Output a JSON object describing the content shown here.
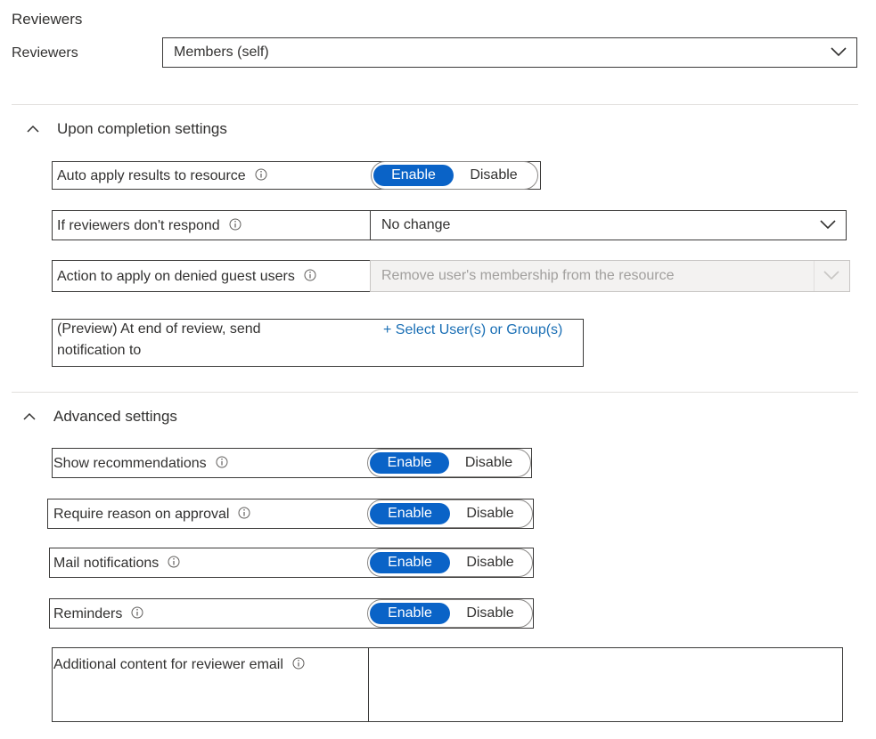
{
  "reviewers": {
    "heading": "Reviewers",
    "label": "Reviewers",
    "value": "Members (self)"
  },
  "completion": {
    "title": "Upon completion settings",
    "auto_apply": {
      "label": "Auto apply results to resource",
      "enable": "Enable",
      "disable": "Disable"
    },
    "no_response": {
      "label": "If reviewers don't respond",
      "value": "No change"
    },
    "denied_guests": {
      "label": "Action to apply on denied guest users",
      "value": "Remove user's membership from the resource"
    },
    "notification": {
      "label_line1": "(Preview) At end of review, send",
      "label_line2": "notification to",
      "link": "+ Select User(s) or Group(s)"
    }
  },
  "advanced": {
    "title": "Advanced settings",
    "show_recommendations": {
      "label": "Show recommendations",
      "enable": "Enable",
      "disable": "Disable"
    },
    "require_reason": {
      "label": "Require reason on approval",
      "enable": "Enable",
      "disable": "Disable"
    },
    "mail_notifications": {
      "label": "Mail notifications",
      "enable": "Enable",
      "disable": "Disable"
    },
    "reminders": {
      "label": "Reminders",
      "enable": "Enable",
      "disable": "Disable"
    },
    "additional_content": {
      "label": "Additional content for reviewer email",
      "value": ""
    }
  },
  "icons": {
    "info": "info-icon",
    "chevron": "chevron-down-icon",
    "collapse": "chevron-up-icon"
  },
  "colors": {
    "accent": "#0a63c7",
    "link": "#1a6fb5",
    "disabled_bg": "#f3f2f1"
  }
}
